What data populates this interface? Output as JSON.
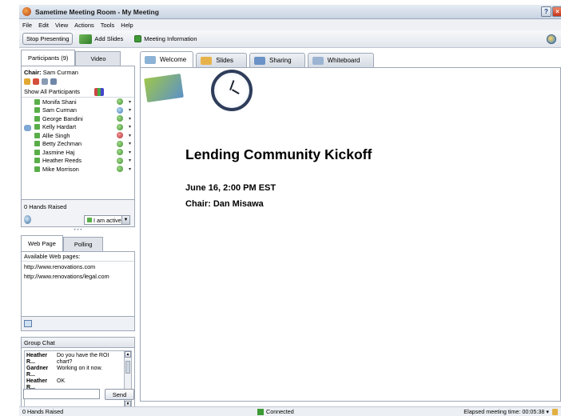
{
  "window": {
    "title": "Sametime Meeting Room - My Meeting"
  },
  "menu": [
    "File",
    "Edit",
    "View",
    "Actions",
    "Tools",
    "Help"
  ],
  "toolbar": {
    "stop_presenting": "Stop Presenting",
    "add_slides": "Add Slides",
    "meeting_info": "Meeting Information"
  },
  "participants_panel": {
    "tab_participants": "Participants (9)",
    "tab_video": "Video",
    "chair_label": "Chair:",
    "chair_name": "Sam Curman",
    "show_label": "Show All Participants",
    "participants": [
      {
        "name": "Monifa Shani",
        "status": "green"
      },
      {
        "name": "Sam Curman",
        "status": "blue"
      },
      {
        "name": "George Bandini",
        "status": "green"
      },
      {
        "name": "Kelly Hardart",
        "status": "green"
      },
      {
        "name": "Allie Singh",
        "status": "red"
      },
      {
        "name": "Betty Zechman",
        "status": "green"
      },
      {
        "name": "Jasmine Haj",
        "status": "green"
      },
      {
        "name": "Heather Reeds",
        "status": "green"
      },
      {
        "name": "Mike Morrison",
        "status": "green"
      }
    ],
    "hands_raised": "0 Hands Raised",
    "activity_value": "I am active",
    "colors": {
      "status_green": "#3c8a2c",
      "status_red": "#b22a2a",
      "status_blue": "#3a7ab8"
    }
  },
  "web_panel": {
    "tab_web_page": "Web Page",
    "tab_polling": "Polling",
    "header": "Available Web pages:",
    "urls": [
      "http://www.renovations.com",
      "http://www.renovations/legal.com"
    ]
  },
  "group_chat": {
    "title": "Group Chat",
    "messages": [
      {
        "who": "Heather R...",
        "msg": "Do you have the ROI chart?"
      },
      {
        "who": "Gardner R...",
        "msg": "Working on it now."
      },
      {
        "who": "Heather R...",
        "msg": "OK"
      }
    ],
    "input_value": "",
    "send_label": "Send"
  },
  "main_tabs": [
    {
      "label": "Welcome",
      "icon": "welcome-icon",
      "active": true
    },
    {
      "label": "Slides",
      "icon": "slides-icon",
      "active": false
    },
    {
      "label": "Sharing",
      "icon": "sharing-icon",
      "active": false
    },
    {
      "label": "Whiteboard",
      "icon": "whiteboard-icon",
      "active": false
    }
  ],
  "welcome": {
    "title": "Lending Community Kickoff",
    "date_line": "June 16, 2:00 PM EST",
    "chair_line": "Chair: Dan Misawa"
  },
  "status_bar": {
    "hands_raised": "0 Hands Raised",
    "connection": "Connected",
    "elapsed": "Elapsed meeting time: 00:05:38"
  }
}
